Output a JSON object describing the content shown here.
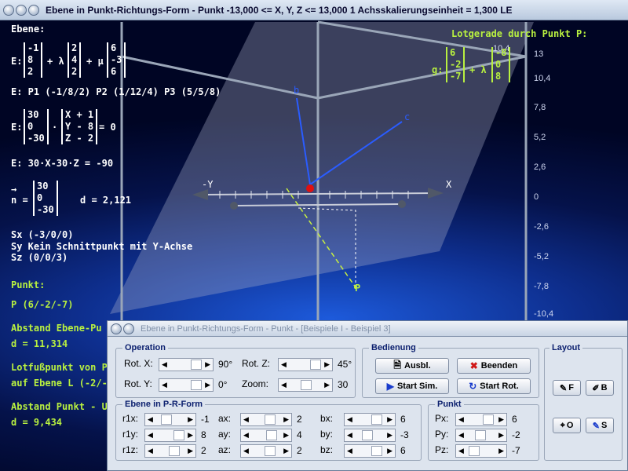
{
  "main_window": {
    "title": "Ebene in Punkt-Richtungs-Form - Punkt    -13,000 <= X, Y, Z <= 13,000    1 Achsskalierungseinheit = 1,300 LE"
  },
  "overlay": {
    "ebene_heading": "Ebene:",
    "e_label": "E:",
    "vec_p": [
      "-1",
      "8",
      "2"
    ],
    "plus_lambda": "+ λ",
    "vec_u": [
      "2",
      "4",
      "2"
    ],
    "plus_mu": "+ μ",
    "vec_v": [
      "6",
      "-3",
      "6"
    ],
    "points_line": "E: P1 (-1/8/2)   P2 (1/12/4)   P3 (5/5/8)",
    "n_vec": [
      "30",
      "0",
      "-30"
    ],
    "dot": "·",
    "xyz_vec": [
      "X + 1",
      "Y - 8",
      "Z - 2"
    ],
    "eq_zero": "= 0",
    "coord_eq": "E: 30·X-30·Z = -90",
    "arrow": "→",
    "n_label": "n =",
    "n_vec2": [
      "30",
      "0",
      "-30"
    ],
    "d_line": "d = 2,121",
    "sx": "Sx (-3/0/0)",
    "sy": "Sy Kein Schnittpunkt mit Y-Achse",
    "sz": "Sz (0/0/3)",
    "punkt_heading": "Punkt:",
    "punkt_value": "P (6/-2/-7)",
    "abstand_ebene": "Abstand Ebene-Pu",
    "abstand_ebene_d": "d = 11,314",
    "lotfuss": "Lotfußpunkt von P",
    "lotfuss_ebene": "auf Ebene L (-2/-2",
    "abstand_punkt": "Abstand Punkt - U",
    "abstand_punkt_d": "d = 9,434",
    "lotgerade_heading": "Lotgerade durch Punkt P:",
    "g_label": "g:",
    "g_vec": [
      "6",
      "-2",
      "-7"
    ],
    "g_plus": "+ λ",
    "g_dir": [
      "-8",
      "0",
      "8"
    ],
    "axis_x": "X",
    "axis_y": "-Y",
    "axis_b": "b",
    "axis_c": "c",
    "point_p": "P",
    "scale_top": "10,4",
    "scale": [
      "13",
      "10,4",
      "7,8",
      "5,2",
      "2,6",
      "0",
      "-2,6",
      "-5,2",
      "-7,8",
      "-10,4"
    ]
  },
  "control_window": {
    "title": "Ebene in Punkt-Richtungs-Form - Punkt - [Beispiele I - Beispiel 3]",
    "operation": {
      "title": "Operation",
      "rot_x_label": "Rot. X:",
      "rot_x_value": "90°",
      "rot_y_label": "Rot. Y:",
      "rot_y_value": "0°",
      "rot_z_label": "Rot. Z:",
      "rot_z_value": "45°",
      "zoom_label": "Zoom:",
      "zoom_value": "30"
    },
    "bedienung": {
      "title": "Bedienung",
      "ausbl": "Ausbl.",
      "beenden": "Beenden",
      "start_sim": "Start Sim.",
      "start_rot": "Start Rot."
    },
    "layout": {
      "title": "Layout",
      "f": "F",
      "b": "B",
      "o": "O",
      "s": "S"
    },
    "ebene_prform": {
      "title": "Ebene in P-R-Form",
      "rows": [
        {
          "l1": "r1x:",
          "v1": "-1",
          "l2": "ax:",
          "v2": "2",
          "l3": "bx:",
          "v3": "6"
        },
        {
          "l1": "r1y:",
          "v1": "8",
          "l2": "ay:",
          "v2": "4",
          "l3": "by:",
          "v3": "-3"
        },
        {
          "l1": "r1z:",
          "v1": "2",
          "l2": "az:",
          "v2": "2",
          "l3": "bz:",
          "v3": "6"
        }
      ]
    },
    "punkt": {
      "title": "Punkt",
      "rows": [
        {
          "l": "Px:",
          "v": "6"
        },
        {
          "l": "Py:",
          "v": "-2"
        },
        {
          "l": "Pz:",
          "v": "-7"
        }
      ]
    }
  }
}
